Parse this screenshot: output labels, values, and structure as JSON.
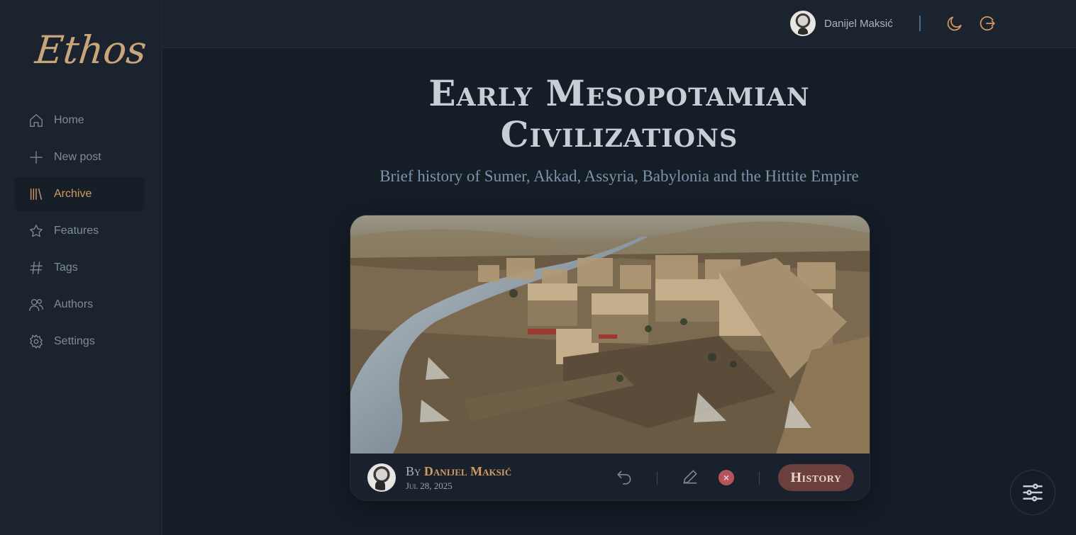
{
  "brand": {
    "logo": "Ethos"
  },
  "sidebar": {
    "items": [
      {
        "label": "Home",
        "icon": "home-icon",
        "active": false
      },
      {
        "label": "New post",
        "icon": "plus-icon",
        "active": false
      },
      {
        "label": "Archive",
        "icon": "library-icon",
        "active": true
      },
      {
        "label": "Features",
        "icon": "star-icon",
        "active": false
      },
      {
        "label": "Tags",
        "icon": "hash-icon",
        "active": false
      },
      {
        "label": "Authors",
        "icon": "users-icon",
        "active": false
      },
      {
        "label": "Settings",
        "icon": "gear-icon",
        "active": false
      }
    ]
  },
  "header": {
    "user_name": "Danijel Maksić",
    "separator": "|",
    "theme_icon": "moon-icon",
    "logout_icon": "logout-icon"
  },
  "post": {
    "title_line1": "Early Mesopotamian",
    "title_line2": "Civilizations",
    "subtitle": "Brief history of Sumer, Akkad, Assyria, Babylonia and the Hittite Empire",
    "image_alt": "Painting of an ancient Mesopotamian river city",
    "byline_prefix": "By",
    "author": "Danijel Maksić",
    "date": "Jul 28, 2025",
    "tag": "History"
  },
  "colors": {
    "accent": "#d29b61",
    "background": "#151d27",
    "sidebar": "#1b232e",
    "tag_bg": "#6c3f3f",
    "delete": "#b5545c"
  }
}
